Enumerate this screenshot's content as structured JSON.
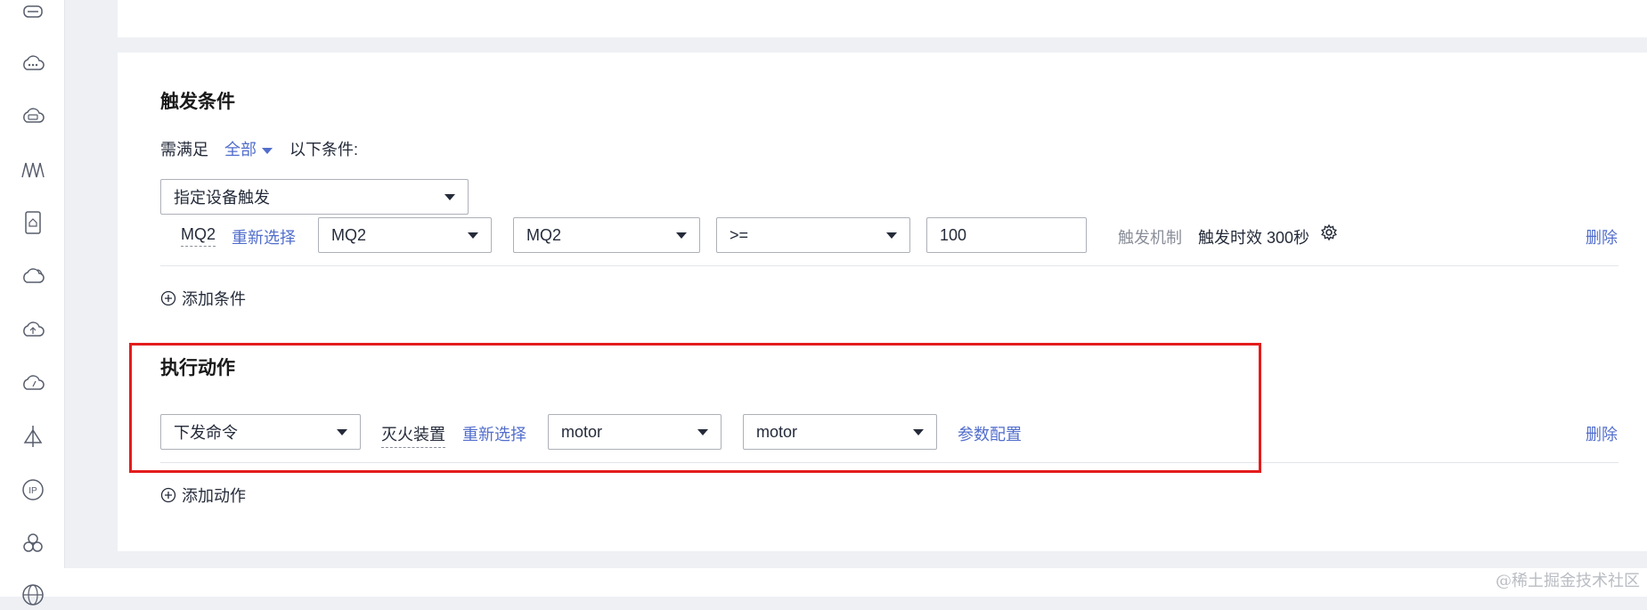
{
  "sidebar": {
    "icons": [
      "router-icon",
      "cloud-dots-icon",
      "cloud-device-icon",
      "wave-icon",
      "tablet-icon",
      "cloud-sync-icon",
      "cloud-upload-icon",
      "cloud-gauge-icon",
      "compass-icon",
      "ip-icon",
      "hexagon-cluster-icon",
      "globe-icon"
    ]
  },
  "trigger": {
    "title": "触发条件",
    "need_label": "需满足",
    "match_mode": "全部",
    "suffix_label": "以下条件:",
    "source_select": "指定设备触发",
    "condition": {
      "device_name": "MQ2",
      "reselect": "重新选择",
      "product_select": "MQ2",
      "property_select": "MQ2",
      "operator_select": ">=",
      "value_input": "100",
      "mechanism_label": "触发机制",
      "mechanism_value": "触发时效 300秒",
      "delete": "删除"
    },
    "add_condition": "添加条件"
  },
  "action": {
    "title": "执行动作",
    "type_select": "下发命令",
    "device_name": "灭火装置",
    "reselect": "重新选择",
    "service_select": "motor",
    "command_select": "motor",
    "param_config": "参数配置",
    "delete": "删除",
    "add_action": "添加动作"
  },
  "watermark": "@稀土掘金技术社区",
  "colors": {
    "link": "#526ecc",
    "highlight": "#e31c1c",
    "background": "#eef0f4"
  }
}
